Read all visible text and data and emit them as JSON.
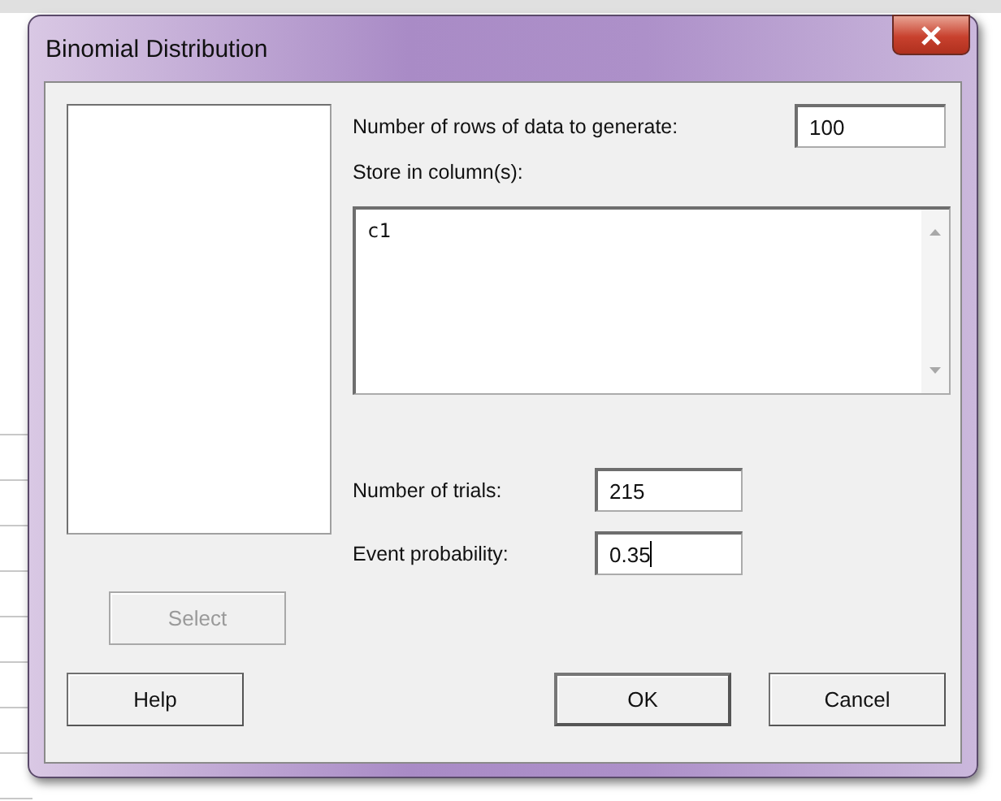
{
  "window": {
    "title": "Binomial Distribution"
  },
  "fields": [
    {
      "kind": "line",
      "label": "Number of rows of data to generate:",
      "value": "100",
      "focused": false
    },
    {
      "kind": "area",
      "label": "Store in column(s):",
      "value": "c1",
      "focused": false
    },
    {
      "kind": "line",
      "label": "Number of trials:",
      "value": "215",
      "focused": false
    },
    {
      "kind": "line",
      "label": "Event probability:",
      "value": "0.35",
      "focused": true
    }
  ],
  "buttons": [
    {
      "kind": "select",
      "label": "Select",
      "disabled": true,
      "default": false
    },
    {
      "kind": "help",
      "label": "Help",
      "disabled": false,
      "default": false
    },
    {
      "kind": "ok",
      "label": "OK",
      "disabled": false,
      "default": true
    },
    {
      "kind": "cancel",
      "label": "Cancel",
      "disabled": false,
      "default": false
    }
  ]
}
